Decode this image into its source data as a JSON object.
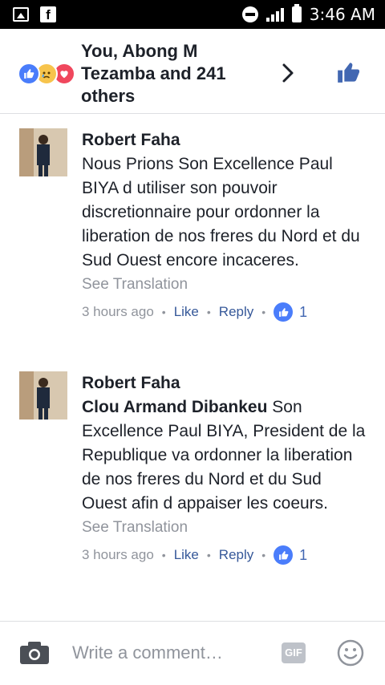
{
  "status_bar": {
    "time": "3:46 AM"
  },
  "header": {
    "reactors_text": "You, Abong M Tezamba and 241 others",
    "reaction_icons": [
      "like-icon",
      "sad-icon",
      "love-icon"
    ]
  },
  "comments": [
    {
      "author": "Robert Faha",
      "tag": "",
      "text": "Nous Prions Son Excellence Paul BIYA d utiliser son pouvoir discretionnaire pour ordonner la liberation de nos freres du Nord et du Sud Ouest encore incaceres.",
      "see_translation": "See Translation",
      "time": "3 hours ago",
      "like_label": "Like",
      "reply_label": "Reply",
      "like_count": "1"
    },
    {
      "author": "Robert Faha",
      "tag": "Clou Armand Dibankeu",
      "text": "Son Excellence Paul BIYA, President de la Republique va ordonner la liberation de nos freres du Nord et du Sud Ouest afin d appaiser les coeurs.",
      "see_translation": "See Translation",
      "time": "3 hours ago",
      "like_label": "Like",
      "reply_label": "Reply",
      "like_count": "1"
    }
  ],
  "composer": {
    "placeholder": "Write a comment…",
    "gif_label": "GIF"
  },
  "colors": {
    "accent": "#4267b2",
    "like_blue": "#4a7dfb",
    "muted": "#90949c"
  }
}
